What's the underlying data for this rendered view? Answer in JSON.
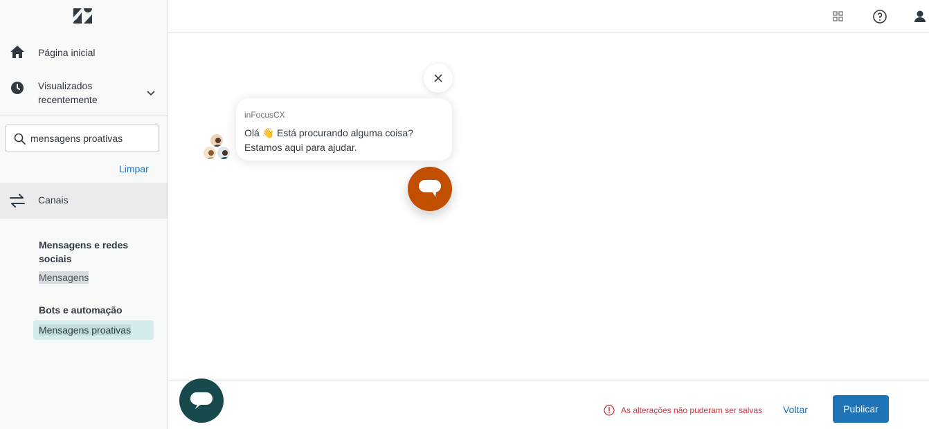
{
  "sidebar": {
    "nav": {
      "home_label": "Página inicial",
      "recent_label": "Visualizados recentemente"
    },
    "search": {
      "value": "mensagens proativas"
    },
    "clear_label": "Limpar",
    "section_label": "Canais",
    "groups": [
      {
        "title": "Mensagens e redes sociais",
        "items": [
          "Mensagens"
        ]
      },
      {
        "title": "Bots e automação",
        "items": [
          "Mensagens proativas"
        ]
      }
    ]
  },
  "header": {
    "icons": [
      "apps-grid-icon",
      "help-icon",
      "user-icon"
    ]
  },
  "preview": {
    "company_name": "inFocusCX",
    "message_line1": "Olá 👋 Está procurando alguma coisa?",
    "message_line2": "Estamos aqui para ajudar.",
    "launcher_color": "#c24e00"
  },
  "footer": {
    "error_text": "As alterações não puderam ser salvas",
    "back_label": "Voltar",
    "publish_label": "Publicar",
    "launcher_color": "#17494d"
  },
  "colors": {
    "accent": "#1f73b7",
    "error": "#cc3340",
    "active_bg": "#d4ecec"
  }
}
